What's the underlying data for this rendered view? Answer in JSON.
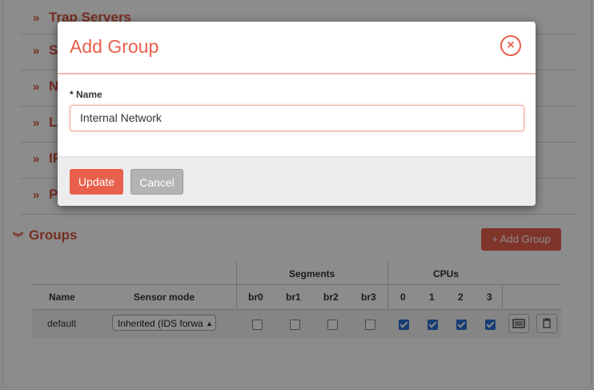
{
  "sections": [
    {
      "label": "Trap Servers"
    },
    {
      "label": "S"
    },
    {
      "label": "N"
    },
    {
      "label": "L"
    },
    {
      "label": "IP"
    },
    {
      "label": "P"
    }
  ],
  "groups": {
    "title": "Groups",
    "add_button": "+ Add Group",
    "headers": {
      "segments": "Segments",
      "cpus": "CPUs",
      "name": "Name",
      "sensor_mode": "Sensor mode",
      "seg_cols": [
        "br0",
        "br1",
        "br2",
        "br3"
      ],
      "cpu_cols": [
        "0",
        "1",
        "2",
        "3"
      ]
    },
    "rows": [
      {
        "name": "default",
        "sensor_mode": "Inherited (IDS forwa",
        "segments": [
          false,
          false,
          false,
          false
        ],
        "cpus": [
          true,
          true,
          true,
          true
        ]
      }
    ]
  },
  "modal": {
    "title": "Add Group",
    "close_icon": "close-icon",
    "name_label": "* Name",
    "name_value": "Internal Network",
    "update_label": "Update",
    "cancel_label": "Cancel"
  },
  "colors": {
    "accent": "#e8604c",
    "checkbox_on": "#2a6fd6"
  }
}
